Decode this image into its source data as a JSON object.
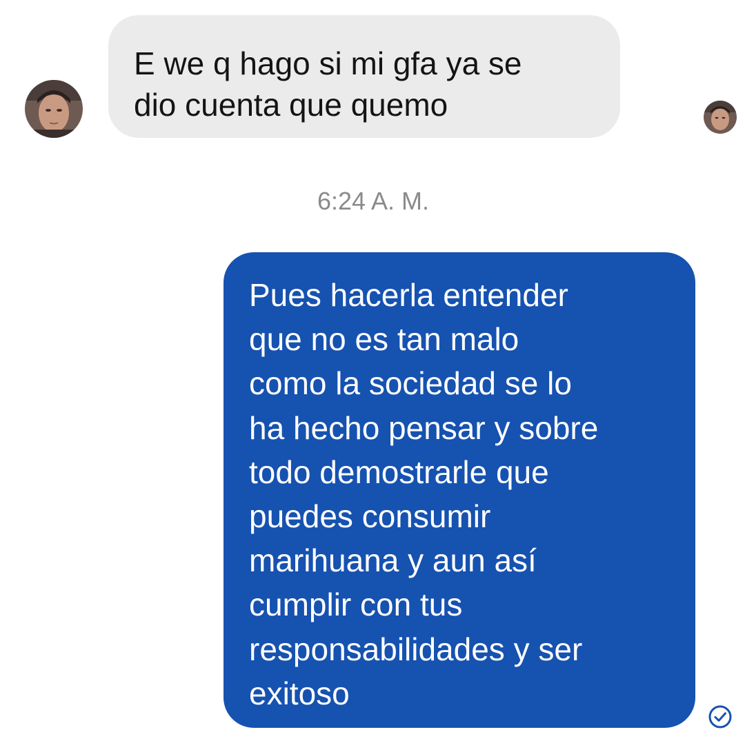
{
  "chat": {
    "messages": [
      {
        "direction": "incoming",
        "text": "E we q hago si mi gfa ya se\ndio cuenta que quemo"
      },
      {
        "direction": "outgoing",
        "text": "Pues hacerla entender\nque no es tan malo\ncomo la sociedad se lo\nha hecho pensar y sobre\ntodo demostrarle que\npuedes consumir\nmarihuana y aun así\ncumplir con tus\nresponsabilidades y ser\nexitoso"
      }
    ],
    "timestamp": "6:24 A. M.",
    "delivery_status_icon": "check-circle-icon"
  },
  "colors": {
    "incoming_bubble": "#ebebeb",
    "outgoing_bubble": "#1652b0",
    "timestamp_text": "#8a8a8a",
    "status_icon": "#1652b0"
  }
}
